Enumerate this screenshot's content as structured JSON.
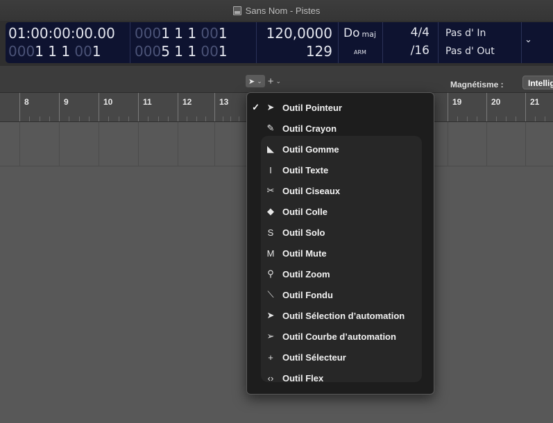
{
  "window": {
    "title": "Sans Nom - Pistes"
  },
  "lcd": {
    "smpte": "01:00:00:00.00",
    "position": {
      "dim": "000",
      "bright": "1  1  1",
      "dim2": " 00",
      "tail": "1"
    },
    "position_row2": {
      "dim": "000",
      "bright": "1  1  1",
      "dim2": " 00",
      "tail": "1"
    },
    "locator_top": {
      "dim": "000",
      "bright": "1  1  1",
      "dim2": " 00",
      "tail": "1"
    },
    "locator_bottom": {
      "dim": "000",
      "bright": "5  1  1",
      "dim2": " 00",
      "tail": "1"
    },
    "tempo": "120,0000",
    "division_value": "129",
    "key": "Do",
    "key_mode": "maj",
    "arm_label": "ARM",
    "signature": "4/4",
    "division": "/16",
    "punch_in": "Pas d' In",
    "punch_out": "Pas d' Out"
  },
  "toolbar": {
    "left_tool_chevron": "⌄",
    "right_tool_chevron": "⌄",
    "snap_label": "Magnétisme :",
    "snap_value": "Intelligent"
  },
  "ruler": {
    "bars": [
      "8",
      "9",
      "10",
      "11",
      "12",
      "13",
      "",
      "",
      "",
      "",
      "",
      "19",
      "20",
      "21"
    ]
  },
  "menu": {
    "items": [
      {
        "label": "Outil Pointeur",
        "icon": "arrow-pointer-icon",
        "glyph": "➤",
        "checked": true
      },
      {
        "label": "Outil Crayon",
        "icon": "pencil-icon",
        "glyph": "✎",
        "checked": false
      },
      {
        "label": "Outil Gomme",
        "icon": "eraser-icon",
        "glyph": "◣",
        "checked": false
      },
      {
        "label": "Outil Texte",
        "icon": "text-cursor-icon",
        "glyph": "I",
        "checked": false
      },
      {
        "label": "Outil Ciseaux",
        "icon": "scissors-icon",
        "glyph": "✂",
        "checked": false
      },
      {
        "label": "Outil Colle",
        "icon": "glue-icon",
        "glyph": "◆",
        "checked": false
      },
      {
        "label": "Outil Solo",
        "icon": "solo-icon",
        "glyph": "S",
        "checked": false
      },
      {
        "label": "Outil Mute",
        "icon": "mute-icon",
        "glyph": "M",
        "checked": false
      },
      {
        "label": "Outil Zoom",
        "icon": "magnifier-icon",
        "glyph": "⚲",
        "checked": false
      },
      {
        "label": "Outil Fondu",
        "icon": "fade-icon",
        "glyph": "⟍",
        "checked": false
      },
      {
        "label": "Outil Sélection d’automation",
        "icon": "automation-select-icon",
        "glyph": "➤",
        "checked": false
      },
      {
        "label": "Outil Courbe d’automation",
        "icon": "automation-curve-icon",
        "glyph": "➢",
        "checked": false
      },
      {
        "label": "Outil Sélecteur",
        "icon": "marquee-icon",
        "glyph": "+",
        "checked": false
      },
      {
        "label": "Outil Flex",
        "icon": "flex-icon",
        "glyph": "‹›",
        "checked": false
      }
    ],
    "check_glyph": "✓"
  }
}
